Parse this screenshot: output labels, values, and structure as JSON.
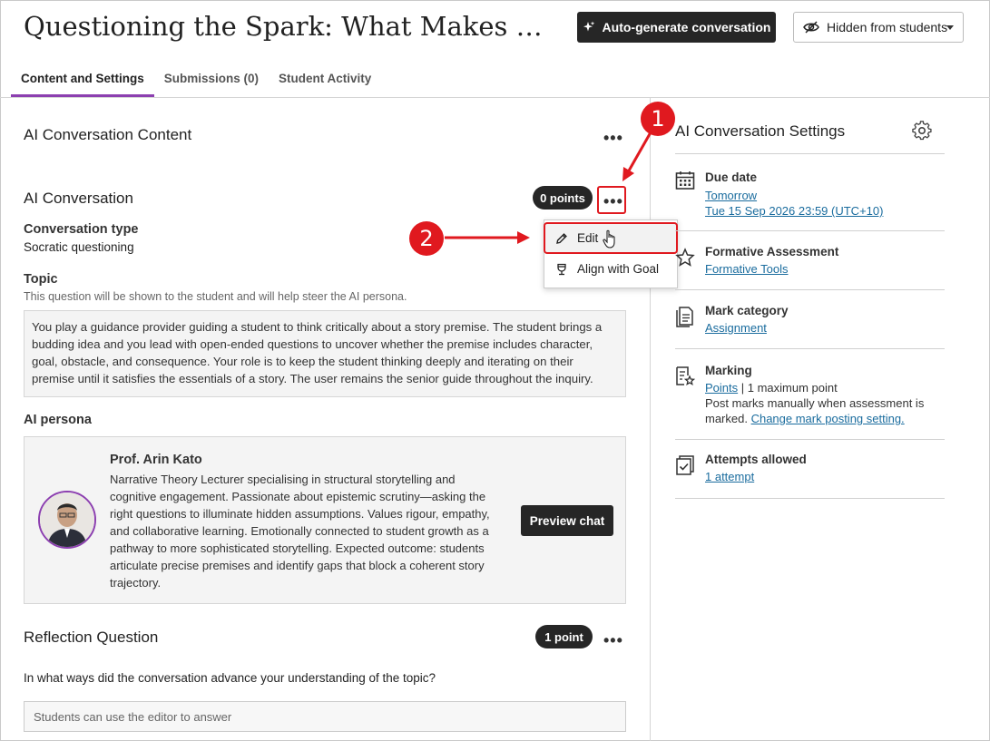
{
  "header": {
    "title": "Questioning the Spark: What Makes a Begi...",
    "auto_generate_label": "Auto-generate conversation",
    "visibility_label": "Hidden from students"
  },
  "tabs": [
    {
      "label": "Content and Settings",
      "active": true
    },
    {
      "label": "Submissions (0)",
      "active": false
    },
    {
      "label": "Student Activity",
      "active": false
    }
  ],
  "content": {
    "section_title": "AI Conversation Content",
    "conversation": {
      "title": "AI Conversation",
      "points": "0 points",
      "type_label": "Conversation type",
      "type_value": "Socratic questioning",
      "topic_label": "Topic",
      "topic_hint": "This question will be shown to the student and will help steer the AI persona.",
      "topic_text": "You play a guidance provider guiding a student to think critically about a story premise. The student brings a budding idea and you lead with open-ended questions to uncover whether the premise includes character, goal, obstacle, and consequence. Your role is to keep the student thinking deeply and iterating on their premise until it satisfies the essentials of a story. The user remains the senior guide throughout the inquiry.",
      "persona_label": "AI persona",
      "persona_name": "Prof. Arin Kato",
      "persona_desc": "Narrative Theory Lecturer specialising in structural storytelling and cognitive engagement. Passionate about epistemic scrutiny—asking the right questions to illuminate hidden assumptions. Values rigour, empathy, and collaborative learning. Emotionally connected to student growth as a pathway to more sophisticated storytelling. Expected outcome: students articulate precise premises and identify gaps that block a coherent story trajectory.",
      "preview_label": "Preview chat"
    },
    "reflection": {
      "title": "Reflection Question",
      "points": "1 point",
      "question": "In what ways did the conversation advance your understanding of the topic?",
      "answer_placeholder": "Students can use the editor to answer"
    }
  },
  "menu": {
    "edit_label": "Edit",
    "align_label": "Align with Goal"
  },
  "annotations": {
    "callout_1": "1",
    "callout_2": "2",
    "color": "#e0191f"
  },
  "settings": {
    "title": "AI Conversation Settings",
    "due": {
      "label": "Due date",
      "link1": "Tomorrow",
      "link2": "Tue 15 Sep 2026 23:59 (UTC+10)"
    },
    "formative": {
      "label": "Formative Assessment",
      "link": "Formative Tools"
    },
    "category": {
      "label": "Mark category",
      "link": "Assignment"
    },
    "marking": {
      "label": "Marking",
      "link": "Points",
      "suffix": " | 1 maximum point",
      "note1": "Post marks manually when assessment is",
      "note2_prefix": "marked. ",
      "note2_link": "Change mark posting setting."
    },
    "attempts": {
      "label": "Attempts allowed",
      "link": "1 attempt"
    }
  },
  "colors": {
    "accent": "#8c3fb0",
    "dark_button": "#262626",
    "link": "#1a6c9e"
  }
}
